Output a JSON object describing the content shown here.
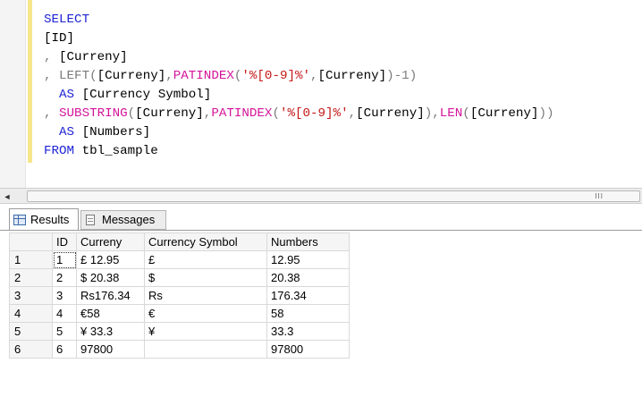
{
  "editor": {
    "lines": [
      {
        "indent": "",
        "parts": [
          {
            "t": "SELECT",
            "c": "kw"
          }
        ]
      },
      {
        "indent": "",
        "parts": [
          {
            "t": "[ID]",
            "c": "id"
          }
        ]
      },
      {
        "indent": "",
        "parts": [
          {
            "t": ", ",
            "c": "gy"
          },
          {
            "t": "[Curreny]",
            "c": "id"
          }
        ]
      },
      {
        "indent": "",
        "parts": [
          {
            "t": ", ",
            "c": "gy"
          },
          {
            "t": "LEFT",
            "c": "gy"
          },
          {
            "t": "(",
            "c": "gy"
          },
          {
            "t": "[Curreny]",
            "c": "id"
          },
          {
            "t": ",",
            "c": "gy"
          },
          {
            "t": "PATINDEX",
            "c": "fn"
          },
          {
            "t": "(",
            "c": "gy"
          },
          {
            "t": "'%[0-9]%'",
            "c": "str"
          },
          {
            "t": ",",
            "c": "gy"
          },
          {
            "t": "[Curreny]",
            "c": "id"
          },
          {
            "t": ")",
            "c": "gy"
          },
          {
            "t": "-1",
            "c": "gy"
          },
          {
            "t": ")",
            "c": "gy"
          }
        ]
      },
      {
        "indent": "  ",
        "parts": [
          {
            "t": "AS",
            "c": "kw"
          },
          {
            "t": " [Currency Symbol]",
            "c": "id"
          }
        ]
      },
      {
        "indent": "",
        "parts": [
          {
            "t": ", ",
            "c": "gy"
          },
          {
            "t": "SUBSTRING",
            "c": "fn"
          },
          {
            "t": "(",
            "c": "gy"
          },
          {
            "t": "[Curreny]",
            "c": "id"
          },
          {
            "t": ",",
            "c": "gy"
          },
          {
            "t": "PATINDEX",
            "c": "fn"
          },
          {
            "t": "(",
            "c": "gy"
          },
          {
            "t": "'%[0-9]%'",
            "c": "str"
          },
          {
            "t": ",",
            "c": "gy"
          },
          {
            "t": "[Curreny]",
            "c": "id"
          },
          {
            "t": ")",
            "c": "gy"
          },
          {
            "t": ",",
            "c": "gy"
          },
          {
            "t": "LEN",
            "c": "fn"
          },
          {
            "t": "(",
            "c": "gy"
          },
          {
            "t": "[Curreny]",
            "c": "id"
          },
          {
            "t": "))",
            "c": "gy"
          }
        ]
      },
      {
        "indent": "  ",
        "parts": [
          {
            "t": "AS",
            "c": "kw"
          },
          {
            "t": " [Numbers]",
            "c": "id"
          }
        ]
      },
      {
        "indent": "",
        "parts": [
          {
            "t": "FROM",
            "c": "kw"
          },
          {
            "t": " tbl_sample",
            "c": "id"
          }
        ]
      }
    ]
  },
  "scrollbar": {
    "left_arrow": "◄",
    "grip": "III"
  },
  "tabs": {
    "results": "Results",
    "messages": "Messages"
  },
  "grid": {
    "columns": [
      "",
      "ID",
      "Curreny",
      "Currency Symbol",
      "Numbers"
    ],
    "rows": [
      [
        "1",
        "1",
        "£ 12.95",
        "£",
        "12.95"
      ],
      [
        "2",
        "2",
        "$ 20.38",
        "$",
        "20.38"
      ],
      [
        "3",
        "3",
        "Rs176.34",
        "Rs",
        "176.34"
      ],
      [
        "4",
        "4",
        "€58",
        "€",
        "58"
      ],
      [
        "5",
        "5",
        "¥ 33.3",
        "¥",
        "33.3"
      ],
      [
        "6",
        "6",
        "97800",
        "",
        "97800"
      ]
    ]
  }
}
